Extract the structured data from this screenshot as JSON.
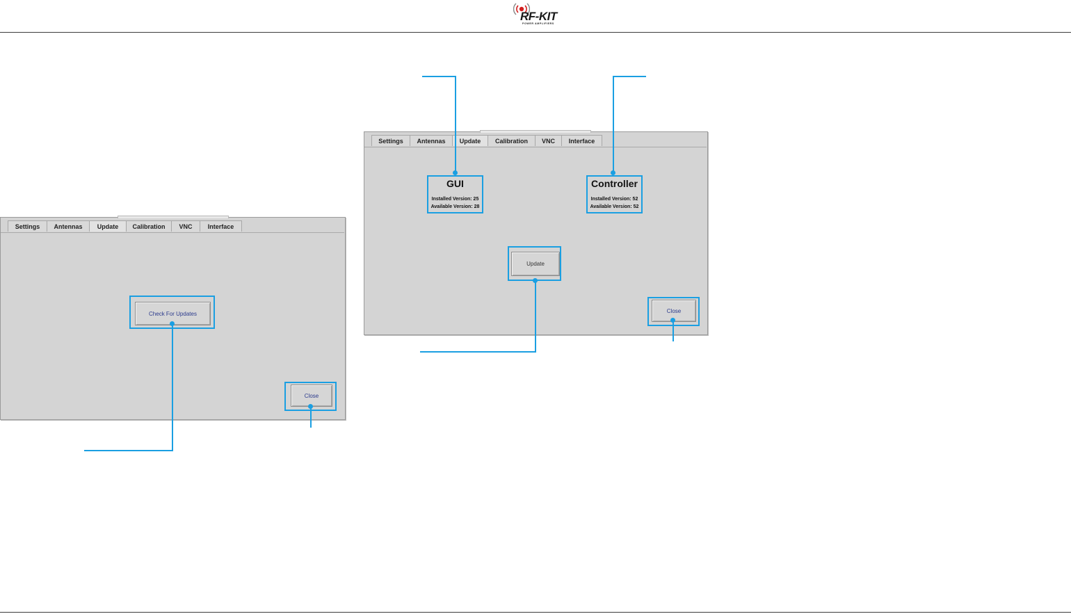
{
  "logo": {
    "name": "RF-KIT",
    "tagline": "POWER AMPLIFIERS"
  },
  "colors": {
    "callout": "#1a9fe2",
    "panel_bg": "#d4d4d4",
    "button_text": "#2b3a8c"
  },
  "screen_left": {
    "tabs": [
      "Settings",
      "Antennas",
      "Update",
      "Calibration",
      "VNC",
      "Interface"
    ],
    "active_tab": "Update",
    "check_button": "Check For Updates",
    "close_button": "Close"
  },
  "screen_right": {
    "tabs": [
      "Settings",
      "Antennas",
      "Update",
      "Calibration",
      "VNC",
      "Interface"
    ],
    "active_tab": "Update",
    "gui": {
      "title": "GUI",
      "installed": "Installed Version: 25",
      "available": "Available Version: 28"
    },
    "controller": {
      "title": "Controller",
      "installed": "Installed Version: 52",
      "available": "Available Version: 52"
    },
    "update_button": "Update",
    "close_button": "Close"
  }
}
